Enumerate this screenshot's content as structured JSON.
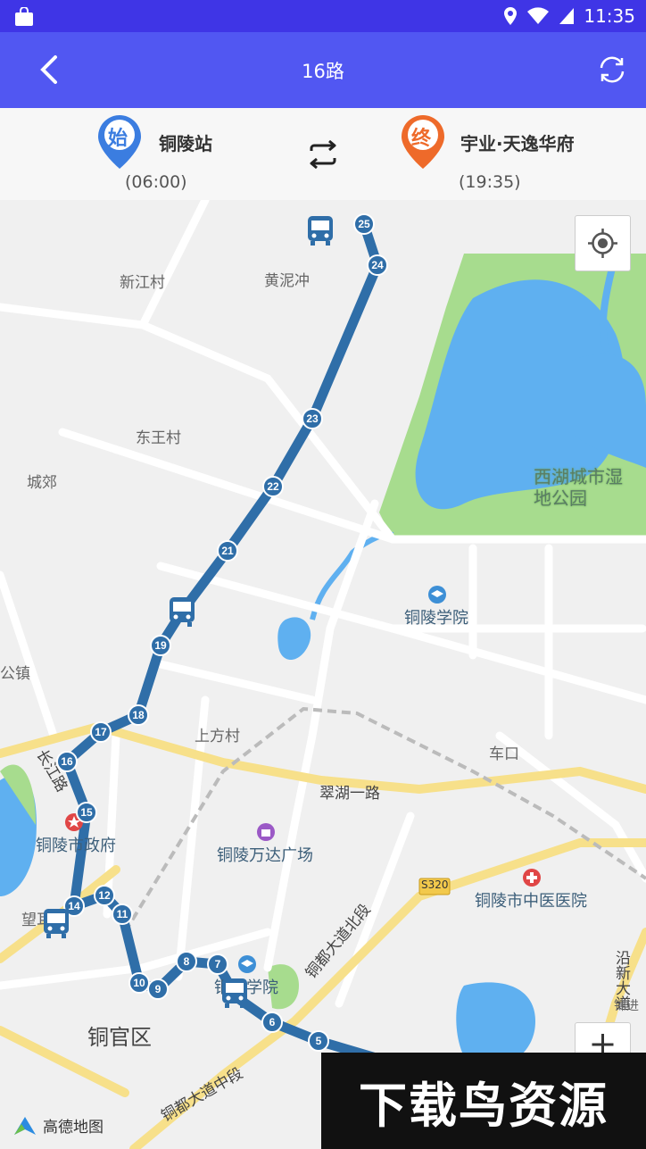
{
  "status": {
    "time": "11:35"
  },
  "header": {
    "title": "16路"
  },
  "origin": {
    "badge": "始",
    "name": "铜陵站",
    "time": "(06:00)",
    "color": "#3b7de0"
  },
  "destination": {
    "badge": "终",
    "name": "宇业·天逸华府",
    "time": "(19:35)",
    "color": "#ee6a2a"
  },
  "map": {
    "place_labels": {
      "xinjiang": "新江村",
      "huangnichong": "黄泥冲",
      "dongwang": "东王村",
      "chengjiao": "城郊",
      "gongzhen": "公镇",
      "shangfang": "上方村",
      "chekou": "车口",
      "cuihu": "翠湖一路",
      "tongguan": "铜官区",
      "wangmei": "望耳",
      "tongdu_north": "铜都大道北段",
      "tongdu_mid": "铜都大道中段",
      "yanxin": "沿新大道",
      "s320": "S320",
      "jinjin": "锦进"
    },
    "pois": {
      "xihu": "西湖城市湿地公园",
      "college": "铜陵学院",
      "gov": "铜陵市政府",
      "wanda": "铜陵万达广场",
      "hospital": "铜陵市中医医院",
      "school": "铜陵学院"
    },
    "stops": [
      "5",
      "6",
      "7",
      "8",
      "9",
      "10",
      "11",
      "12",
      "14",
      "15",
      "16",
      "17",
      "18",
      "19",
      "21",
      "22",
      "23",
      "24",
      "25"
    ],
    "road_name_vertical": "长江路",
    "provider": "高德地图",
    "route_color": "#2f6ea8"
  },
  "watermark": "下载鸟资源"
}
